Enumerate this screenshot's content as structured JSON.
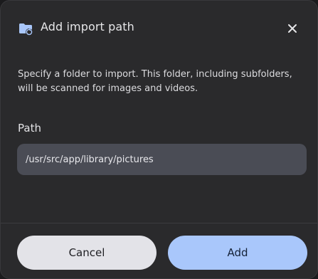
{
  "dialog": {
    "title": "Add import path",
    "icon": "folder-sync-icon",
    "close_icon": "close-icon",
    "description": "Specify a folder to import. This folder, including subfolders, will be scanned for images and videos.",
    "path_label": "Path",
    "path_value": "/usr/src/app/library/pictures",
    "cancel_label": "Cancel",
    "add_label": "Add"
  },
  "colors": {
    "dialog_bg": "#2a2a2c",
    "input_bg": "#4a4c55",
    "primary": "#a9c7fb",
    "secondary": "#e3e3e8",
    "icon": "#a9c7fb"
  }
}
